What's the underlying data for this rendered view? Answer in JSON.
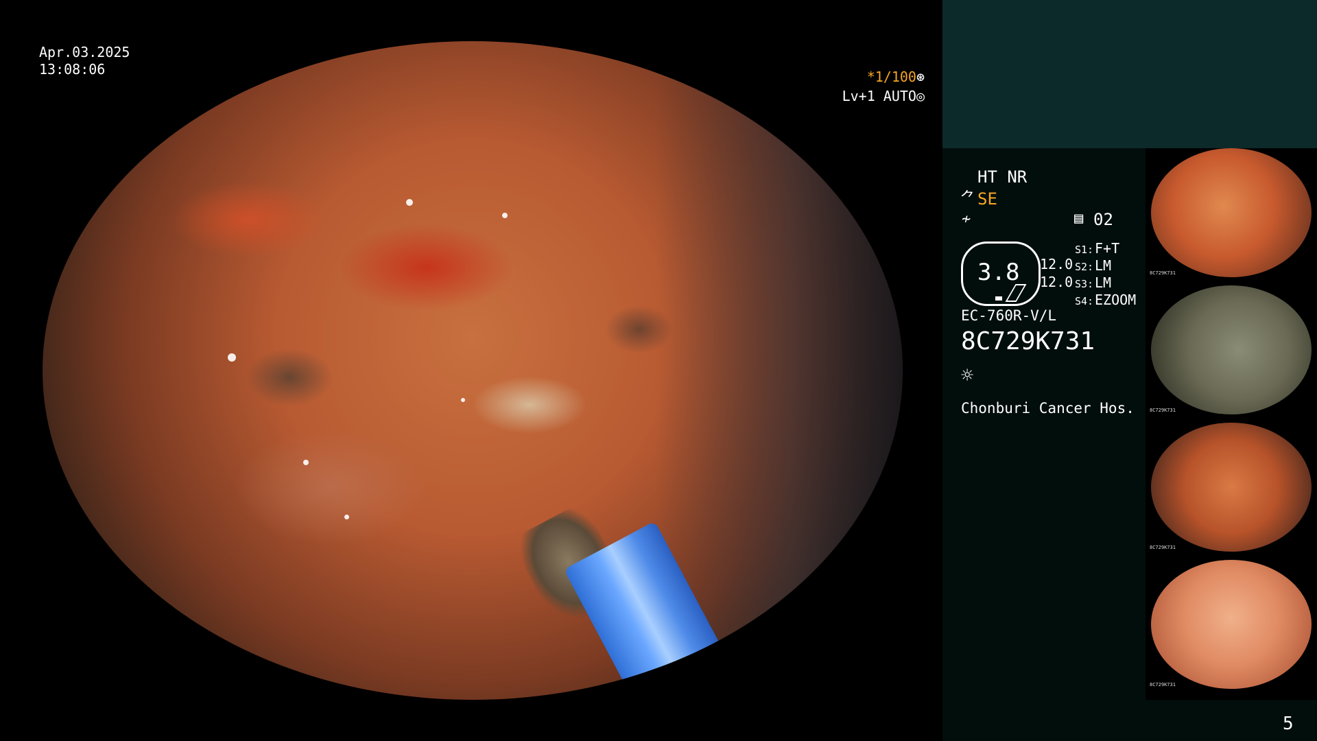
{
  "osd": {
    "date": "Apr.03.2025",
    "time": "13:08:06",
    "shutter": "*1/100",
    "level": "Lv+1 AUTO",
    "shutter_icon": "⊛",
    "auto_icon": "◎"
  },
  "panel": {
    "ht_nr": "HT NR",
    "se_icon_glyph": "⺈",
    "se_mode": "SE",
    "freq_icon_glyph": "≁",
    "doc_icon_glyph": "▤",
    "doc_number": "02",
    "zoom_value": "3.8",
    "numbers": [
      "12.0",
      "12.0"
    ],
    "settings": [
      {
        "label": "S1:",
        "value": "F+T"
      },
      {
        "label": "S2:",
        "value": "LM"
      },
      {
        "label": "S3:",
        "value": "LM"
      },
      {
        "label": "S4:",
        "value": "EZOOM"
      }
    ],
    "model": "EC-760R-V/L",
    "serial": "8C729K731",
    "light_icon_glyph": "☼",
    "hospital": "Chonburi Cancer Hos."
  },
  "thumbnails": [
    {
      "caption": "8C729K731"
    },
    {
      "caption": "8C729K731"
    },
    {
      "caption": "8C729K731"
    },
    {
      "caption": "8C729K731"
    }
  ],
  "page_number": "5",
  "colors": {
    "accent_orange": "#f6a623",
    "panel_top": "#0d2a2a",
    "panel_bottom": "#020e0c"
  }
}
